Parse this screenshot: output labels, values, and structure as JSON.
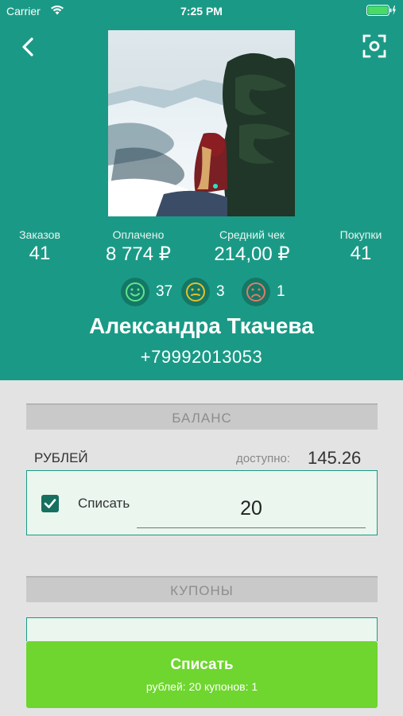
{
  "status": {
    "carrier": "Carrier",
    "time": "7:25 PM"
  },
  "colors": {
    "header": "#1a9a86",
    "accent_dark": "#16705f",
    "button": "#6ed62e",
    "background": "#e3e3e3"
  },
  "header": {
    "stats": [
      {
        "label": "Заказов",
        "value": "41"
      },
      {
        "label": "Оплачено",
        "value": "8 774 ₽"
      },
      {
        "label": "Средний чек",
        "value": "214,00 ₽"
      },
      {
        "label": "Покупки",
        "value": "41"
      }
    ],
    "moods": [
      {
        "icon": "happy-face-icon",
        "count": "37"
      },
      {
        "icon": "neutral-face-icon",
        "count": "3"
      },
      {
        "icon": "sad-face-icon",
        "count": "1"
      }
    ],
    "name": "Александра Ткачева",
    "phone": "+79992013053"
  },
  "balance": {
    "section_title": "БАЛАНС",
    "currency_label": "РУБЛЕЙ",
    "available_label": "доступно:",
    "available_value": "145.26",
    "write_off_label": "Списать",
    "amount": "20",
    "checked": true
  },
  "coupons": {
    "section_title": "КУПОНЫ"
  },
  "submit": {
    "label": "Списать",
    "summary": "рублей: 20 купонов: 1"
  }
}
